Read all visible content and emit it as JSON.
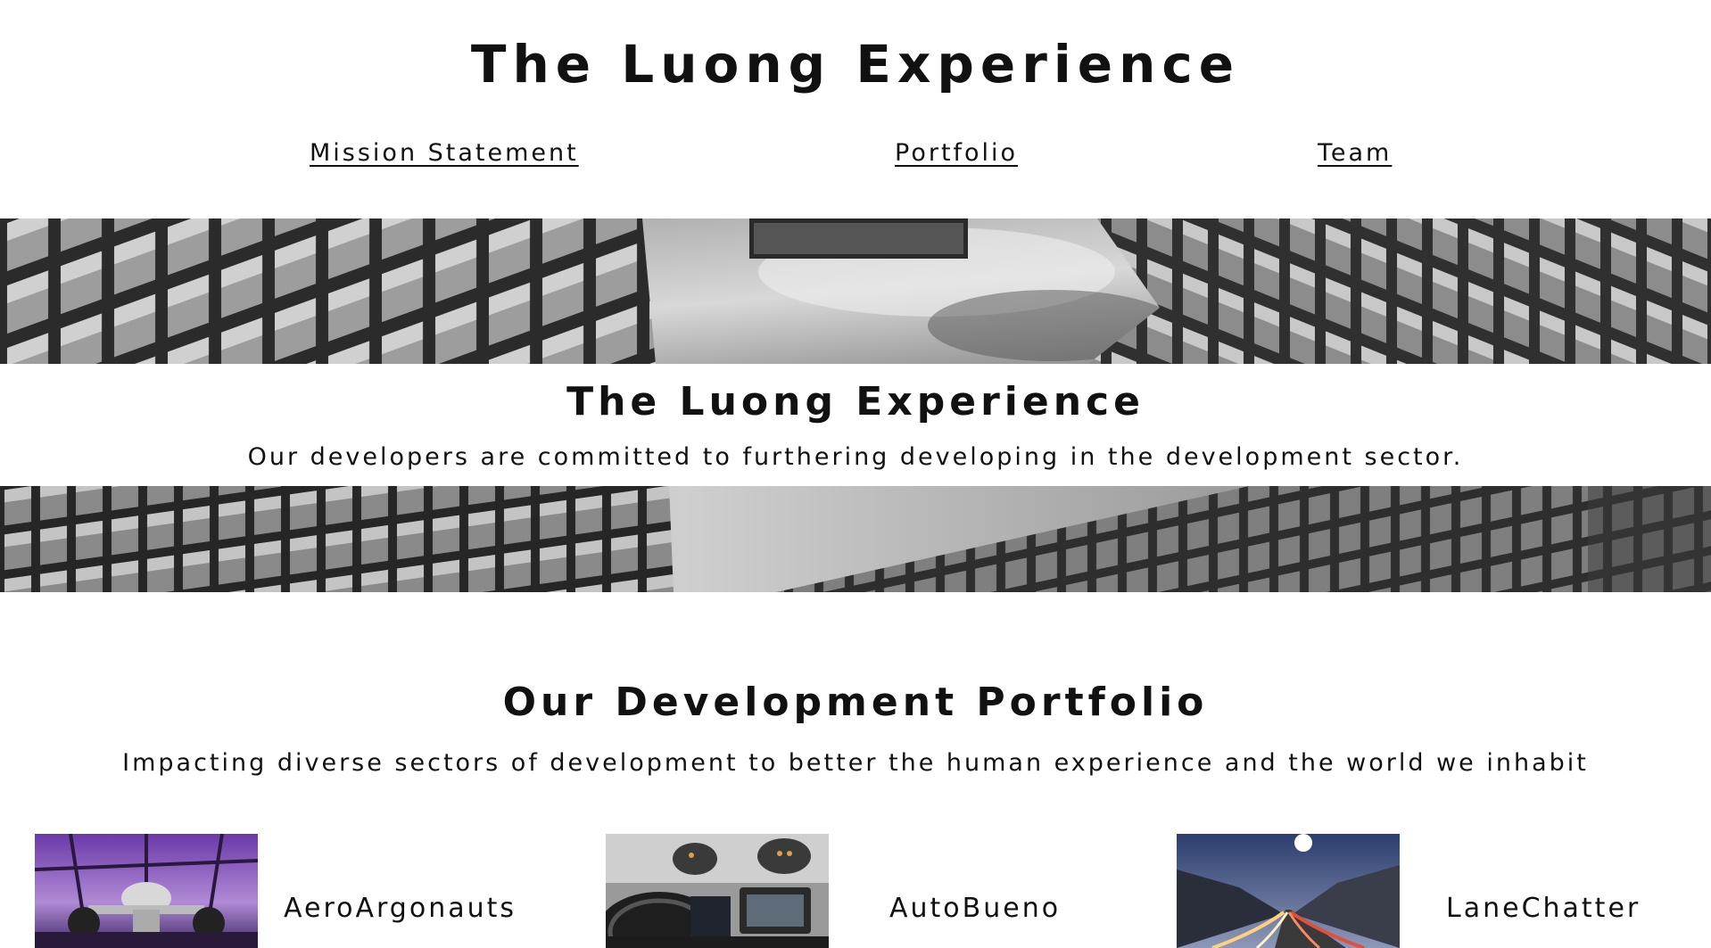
{
  "header": {
    "title": "The Luong Experience",
    "nav": [
      {
        "label": "Mission Statement"
      },
      {
        "label": "Portfolio"
      },
      {
        "label": "Team"
      }
    ]
  },
  "hero": {
    "title": "The Luong Experience",
    "subtitle": "Our developers are committed to furthering developing in the development sector."
  },
  "portfolio": {
    "title": "Our Development Portfolio",
    "subtitle": "Impacting diverse sectors of development to better the human experience and the world we inhabit",
    "projects": [
      {
        "name": "AeroArgonauts",
        "image": "aircraft-hangar-photo"
      },
      {
        "name": "AutoBueno",
        "image": "car-dashboard-photo"
      },
      {
        "name": "LaneChatter",
        "image": "highway-light-trails-photo"
      }
    ]
  },
  "colors": {
    "text": "#111111",
    "background": "#ffffff"
  }
}
